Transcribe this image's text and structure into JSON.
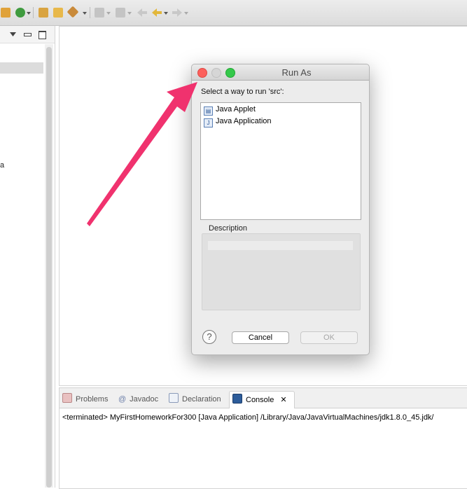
{
  "toolbar": {
    "icons": [
      "new-package-icon",
      "run-config-icon",
      "open-type-icon",
      "open-folder-icon",
      "search-icon",
      "next-annotation-icon",
      "prev-annotation-icon",
      "back-icon",
      "forward-icon",
      "nav-forward-icon"
    ]
  },
  "left_panel": {
    "truncated_text": "a"
  },
  "bottom_tabs": {
    "tabs": [
      {
        "label": "Problems",
        "icon": "problems-icon"
      },
      {
        "label": "Javadoc",
        "icon": "javadoc-icon"
      },
      {
        "label": "Declaration",
        "icon": "declaration-icon"
      },
      {
        "label": "Console",
        "icon": "console-icon",
        "active": true
      }
    ],
    "console_line": "<terminated> MyFirstHomeworkFor300 [Java Application] /Library/Java/JavaVirtualMachines/jdk1.8.0_45.jdk/"
  },
  "dialog": {
    "title": "Run As",
    "prompt": "Select a way to run 'src':",
    "options": [
      {
        "label": "Java Applet",
        "icon": "java-applet-icon"
      },
      {
        "label": "Java Application",
        "icon": "java-application-icon"
      }
    ],
    "description_label": "Description",
    "help_symbol": "?",
    "cancel_label": "Cancel",
    "ok_label": "OK"
  },
  "colors": {
    "close": "#fc605c",
    "minimize": "#d6d6d6",
    "zoom": "#34c84a",
    "annotation_arrow": "#f0326e"
  }
}
